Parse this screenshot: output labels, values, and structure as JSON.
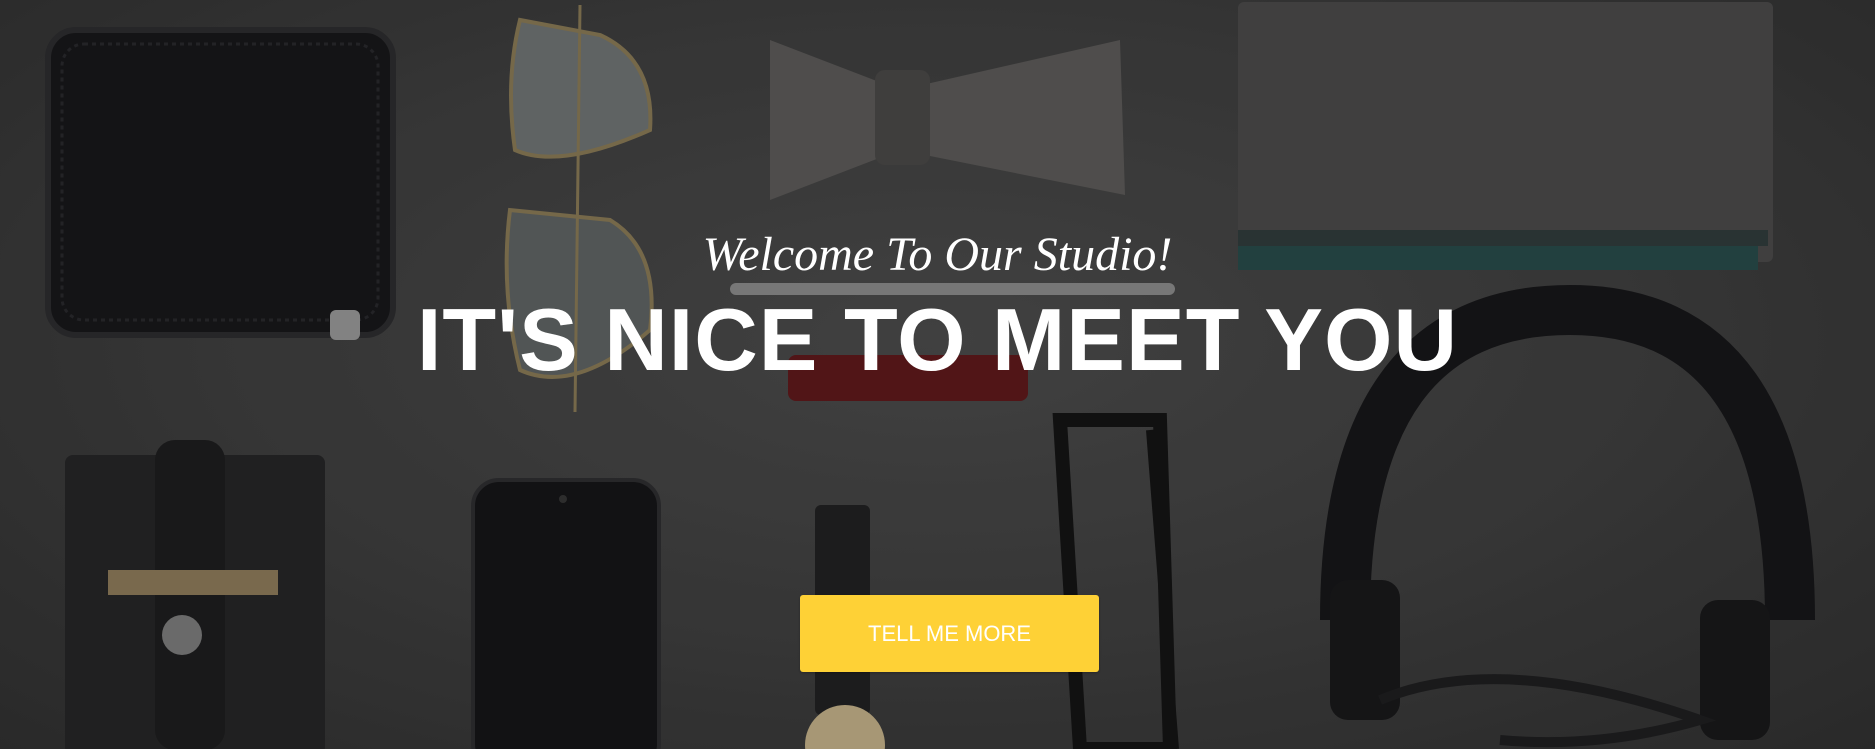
{
  "hero": {
    "lead": "Welcome To Our Studio!",
    "heading": "IT'S NICE TO MEET YOU",
    "button_label": "TELL ME MORE"
  },
  "colors": {
    "accent": "#fed136",
    "text": "#ffffff",
    "background": "#3b3b3b"
  }
}
